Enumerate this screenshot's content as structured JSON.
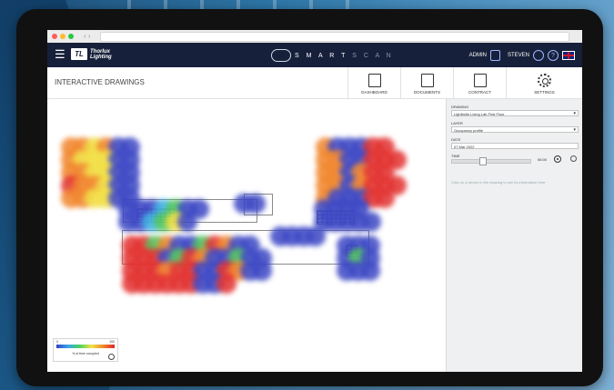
{
  "header": {
    "logo_mark": "TL",
    "logo_line1": "Thorlux",
    "logo_line2": "Lighting",
    "product_smart": "S M A R T",
    "product_scan": "S C A N",
    "admin_label": "ADMIN",
    "user_label": "STEVEN",
    "help_glyph": "?"
  },
  "page": {
    "title": "INTERACTIVE DRAWINGS"
  },
  "nav": [
    {
      "label": "DASHBOARD",
      "icon": "dashboard-icon"
    },
    {
      "label": "DOCUMENTS",
      "icon": "documents-icon"
    },
    {
      "label": "CONTRACT",
      "icon": "contract-icon"
    },
    {
      "label": "SETTINGS",
      "icon": "gear-icon"
    }
  ],
  "panel": {
    "drawing_label": "DRAWING",
    "drawing_value": "Lightbolts Living Lab First Floor",
    "layer_label": "LAYER",
    "layer_value": "Occupancy profile",
    "date_label": "DATE",
    "date_value": "07 Mar 2022",
    "time_label": "TIME",
    "time_value": "06:00",
    "time_fraction": 0.38,
    "hint": "Click on a device in the drawing to see its information here"
  },
  "legend": {
    "min": "0",
    "max": "100",
    "caption": "% of time occupied"
  },
  "colors": {
    "header_bg": "#17203a",
    "panel_bg": "#eef0f2"
  }
}
